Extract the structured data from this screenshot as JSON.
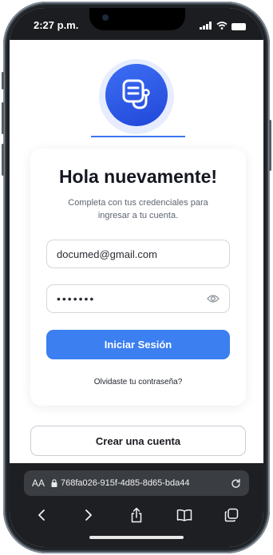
{
  "status_bar": {
    "time": "2:27 p.m."
  },
  "app": {
    "logo_icon": "stethoscope-icon",
    "brand_color": "#3b6ff4",
    "title": "Hola nuevamente!",
    "subtitle": "Completa con tus credenciales para ingresar a tu cuenta.",
    "email_value": "documed@gmail.com",
    "password_value": "•••••••",
    "password_toggle_icon": "eye-icon",
    "login_label": "Iniciar Sesión",
    "forgot_label": "Olvidaste tu contraseña?",
    "create_account_label": "Crear una cuenta"
  },
  "browser": {
    "text_size_label": "AA",
    "url": "768fa026-915f-4d85-8d65-bda44",
    "toolbar_icons": [
      "back-icon",
      "forward-icon",
      "share-icon",
      "bookmarks-icon",
      "tabs-icon"
    ]
  }
}
